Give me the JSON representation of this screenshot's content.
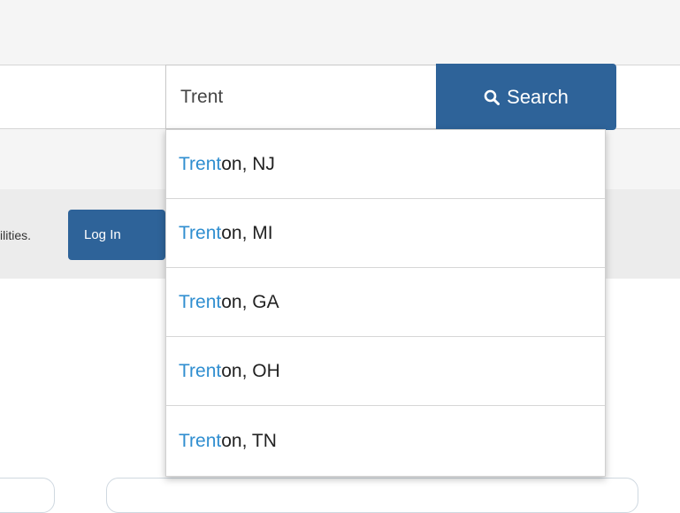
{
  "search": {
    "value": "Trent",
    "button_label": "Search",
    "icon": "search-icon"
  },
  "notice": {
    "text_fragment": "ilities.",
    "login_label": "Log In"
  },
  "suggestions": [
    {
      "match": "Trent",
      "rest": "on, NJ"
    },
    {
      "match": "Trent",
      "rest": "on, MI"
    },
    {
      "match": "Trent",
      "rest": "on, GA"
    },
    {
      "match": "Trent",
      "rest": "on, OH"
    },
    {
      "match": "Trent",
      "rest": "on, TN"
    }
  ],
  "colors": {
    "accent": "#2e6399",
    "match_highlight": "#2f8ed0"
  }
}
